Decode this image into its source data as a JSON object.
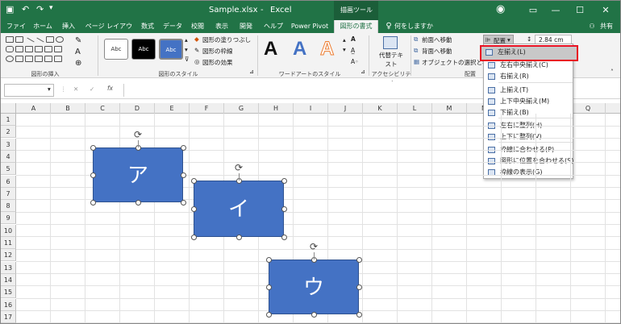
{
  "title_bar": {
    "filename": "Sample.xlsx",
    "separator": "-",
    "app": "Excel",
    "context_tool": "描画ツール",
    "account_icon": "user-icon"
  },
  "tabs": [
    "ファイル",
    "ホーム",
    "挿入",
    "ページ レイアウト",
    "数式",
    "データ",
    "校閲",
    "表示",
    "開発",
    "ヘルプ",
    "Power Pivot",
    "図形の書式"
  ],
  "active_tab": "図形の書式",
  "tell_me": "何をしますか",
  "share": "共有",
  "ribbon": {
    "groups": {
      "insert_shapes": "図形の挿入",
      "shape_styles": "図形のスタイル",
      "wordart_styles": "ワードアートのスタイル",
      "accessibility": "アクセシビリティ",
      "arrange": "配置"
    },
    "style_sample": "Abc",
    "shape_fill": "図形の塗りつぶし",
    "shape_outline": "図形の枠線",
    "shape_effects": "図形の効果",
    "wordart_letter": "A",
    "alt_text": "代替テキスト",
    "bring_forward": "前面へ移動",
    "send_backward": "背面へ移動",
    "selection_pane": "オブジェクトの選択と表示",
    "align_button": "配置",
    "size_value": "2.84 cm"
  },
  "formula_bar": {
    "name_box": "",
    "fx": "fx",
    "cancel": "✕",
    "enter": "✓"
  },
  "columns": [
    "A",
    "B",
    "C",
    "D",
    "E",
    "F",
    "G",
    "H",
    "I",
    "J",
    "K",
    "L",
    "M",
    "N",
    "O",
    "P",
    "Q"
  ],
  "rows": [
    "1",
    "2",
    "3",
    "4",
    "5",
    "6",
    "7",
    "8",
    "9",
    "10",
    "11",
    "12",
    "13",
    "14",
    "15",
    "16",
    "17"
  ],
  "shapes": [
    {
      "text": "ア"
    },
    {
      "text": "イ"
    },
    {
      "text": "ウ"
    }
  ],
  "align_menu": {
    "items": [
      "左揃え(L)",
      "左右中央揃え(C)",
      "右揃え(R)",
      "上揃え(T)",
      "上下中央揃え(M)",
      "下揃え(B)",
      "左右に整列(H)",
      "上下に整列(V)",
      "枠線に合わせる(P)",
      "図形に位置を合わせる(S)",
      "枠線の表示(G)"
    ],
    "highlighted": "左揃え(L)",
    "highlight_color": "#e81123"
  },
  "colors": {
    "excel_green": "#217346",
    "shape_fill": "#4472c4"
  }
}
